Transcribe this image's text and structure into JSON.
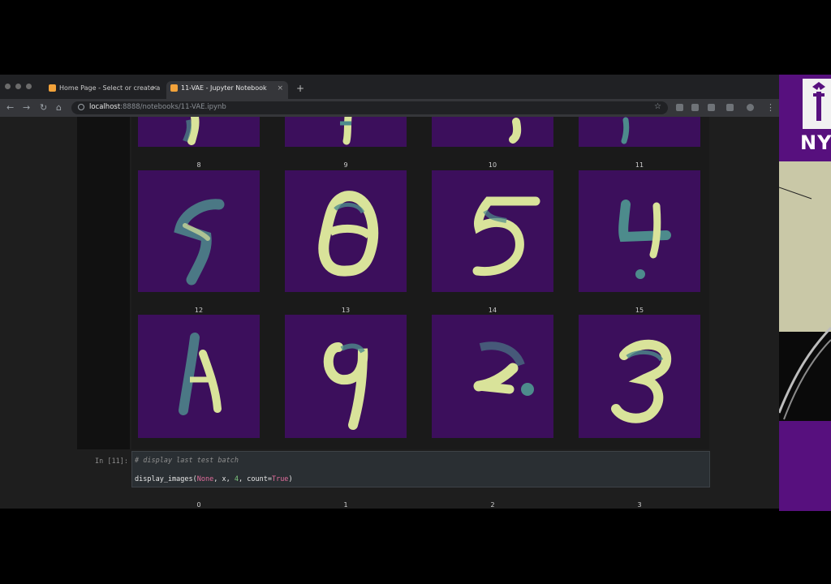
{
  "browser": {
    "tabs": [
      {
        "title": "Home Page - Select or create a",
        "active": false
      },
      {
        "title": "11-VAE - Jupyter Notebook",
        "active": true
      }
    ],
    "new_tab": "+",
    "close_glyph": "×",
    "url_host": "localhost",
    "url_rest": ":8888/notebooks/11-VAE.ipynb",
    "nav_icons": [
      "back-icon",
      "forward-icon",
      "reload-icon",
      "home-icon"
    ],
    "extension_icons": [
      "extension-icon",
      "extension-icon",
      "extension-icon",
      "extension-icon",
      "profile-icon",
      "menu-icon"
    ]
  },
  "notebook": {
    "image_labels_row2": [
      "8",
      "9",
      "10",
      "11"
    ],
    "image_labels_row3": [
      "12",
      "13",
      "14",
      "15"
    ],
    "output_labels_bottom": [
      "0",
      "1",
      "2",
      "3"
    ],
    "cell_prompt": "In [11]:",
    "code_comment": "# display last test batch",
    "code_fn": "display_images",
    "code_none": "None",
    "code_args": ", x, ",
    "code_num": "4",
    "code_kw": "count",
    "code_true": "True",
    "code_open": "(",
    "code_close": ")",
    "code_eq": "=",
    "code_comma": ", "
  },
  "sidebar": {
    "logo_text": "NY"
  },
  "colors": {
    "digit_bg": "#3c0f5c",
    "digit_fg": "#d9e39a",
    "digit_mid": "#4d8b8c",
    "nyu_purple": "#57107e"
  }
}
